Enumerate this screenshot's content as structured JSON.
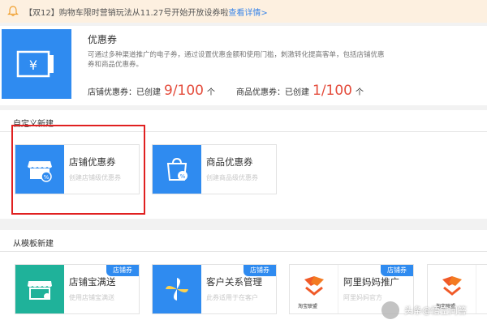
{
  "notice": {
    "text": "【双12】购物车限时营销玩法从11.27号开始开放设券啦",
    "link": "查看详情>"
  },
  "header": {
    "title": "优惠券",
    "description": "可通过多种渠道推广的电子券，通过设置优惠金额和使用门槛，刺激转化提高客单，包括店铺优惠券和商品优惠券。",
    "shop_label": "店铺优惠券：已创建",
    "shop_count": "9/100",
    "shop_unit": "个",
    "item_label": "商品优惠券：已创建",
    "item_count": "1/100",
    "item_unit": "个"
  },
  "custom": {
    "title": "自定义新建",
    "cards": [
      {
        "title": "店铺优惠券",
        "desc": "创建店铺级优惠券"
      },
      {
        "title": "商品优惠券",
        "desc": "创建商品级优惠券"
      }
    ]
  },
  "template": {
    "title": "从模板新建",
    "cards": [
      {
        "title": "店铺宝满送",
        "desc": "使用店铺宝满送",
        "tag": "店铺券"
      },
      {
        "title": "客户关系管理",
        "desc": "此券适用于在客户",
        "tag": "店铺券"
      },
      {
        "title": "阿里妈妈推广",
        "desc": "阿里妈妈官方",
        "tag": "店铺券",
        "logo": "淘宝联盟"
      },
      {
        "title": "",
        "desc": "",
        "tag": "",
        "logo": "淘宝联盟"
      }
    ]
  },
  "watermark": "头条@悟空问答",
  "colors": {
    "accent": "#2f8bf0",
    "count": "#e44c3c",
    "highlight": "#e02020",
    "notice_bg": "#fdf0e0"
  }
}
